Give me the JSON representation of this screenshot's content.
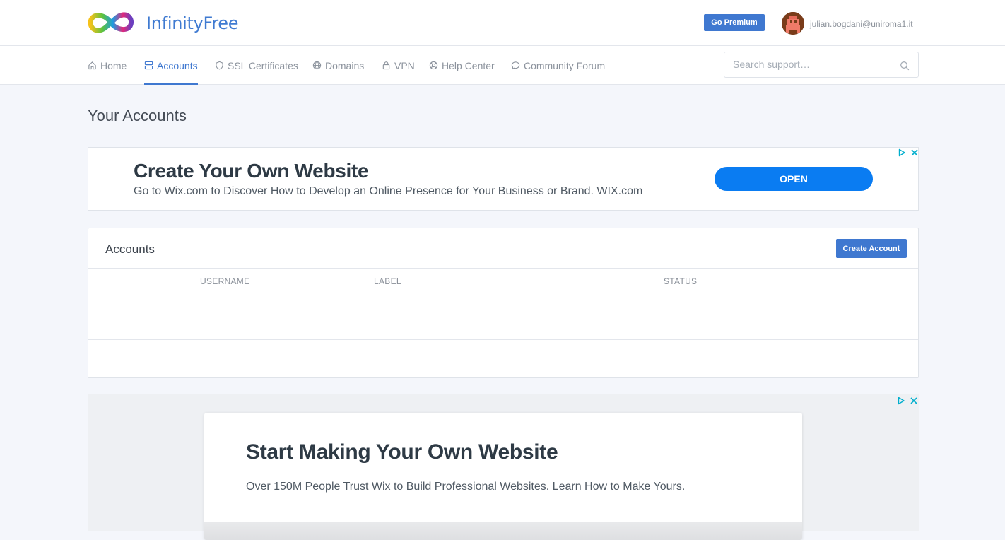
{
  "header": {
    "brand": "InfinityFree",
    "premium_label": "Go Premium",
    "user_email": "julian.bogdani@uniroma1.it"
  },
  "nav": {
    "items": [
      {
        "label": "Home",
        "icon": "home-icon"
      },
      {
        "label": "Accounts",
        "icon": "server-icon",
        "active": true
      },
      {
        "label": "SSL Certificates",
        "icon": "shield-icon"
      },
      {
        "label": "Domains",
        "icon": "globe-icon"
      },
      {
        "label": "VPN",
        "icon": "lock-icon"
      },
      {
        "label": "Help Center",
        "icon": "lifebuoy-icon"
      },
      {
        "label": "Community Forum",
        "icon": "chat-bubble-icon"
      }
    ],
    "search_placeholder": "Search support…"
  },
  "page": {
    "title": "Your Accounts"
  },
  "ad_top": {
    "title": "Create Your Own Website",
    "subtitle": "Go to Wix.com to Discover How to Develop an Online Presence for Your Business or Brand. WIX.com",
    "button": "OPEN"
  },
  "accounts_panel": {
    "title": "Accounts",
    "create_label": "Create Account",
    "columns": [
      "USERNAME",
      "LABEL",
      "STATUS"
    ],
    "rows": []
  },
  "ad_bottom": {
    "title": "Start Making Your Own Website",
    "subtitle": "Over 150M People Trust Wix to Build Professional Websites. Learn How to Make Yours."
  },
  "colors": {
    "primary": "#3f78d0",
    "ad_button": "#0a7cf2",
    "page_bg": "#f4f6fb",
    "adchoices": "#00aecd"
  }
}
